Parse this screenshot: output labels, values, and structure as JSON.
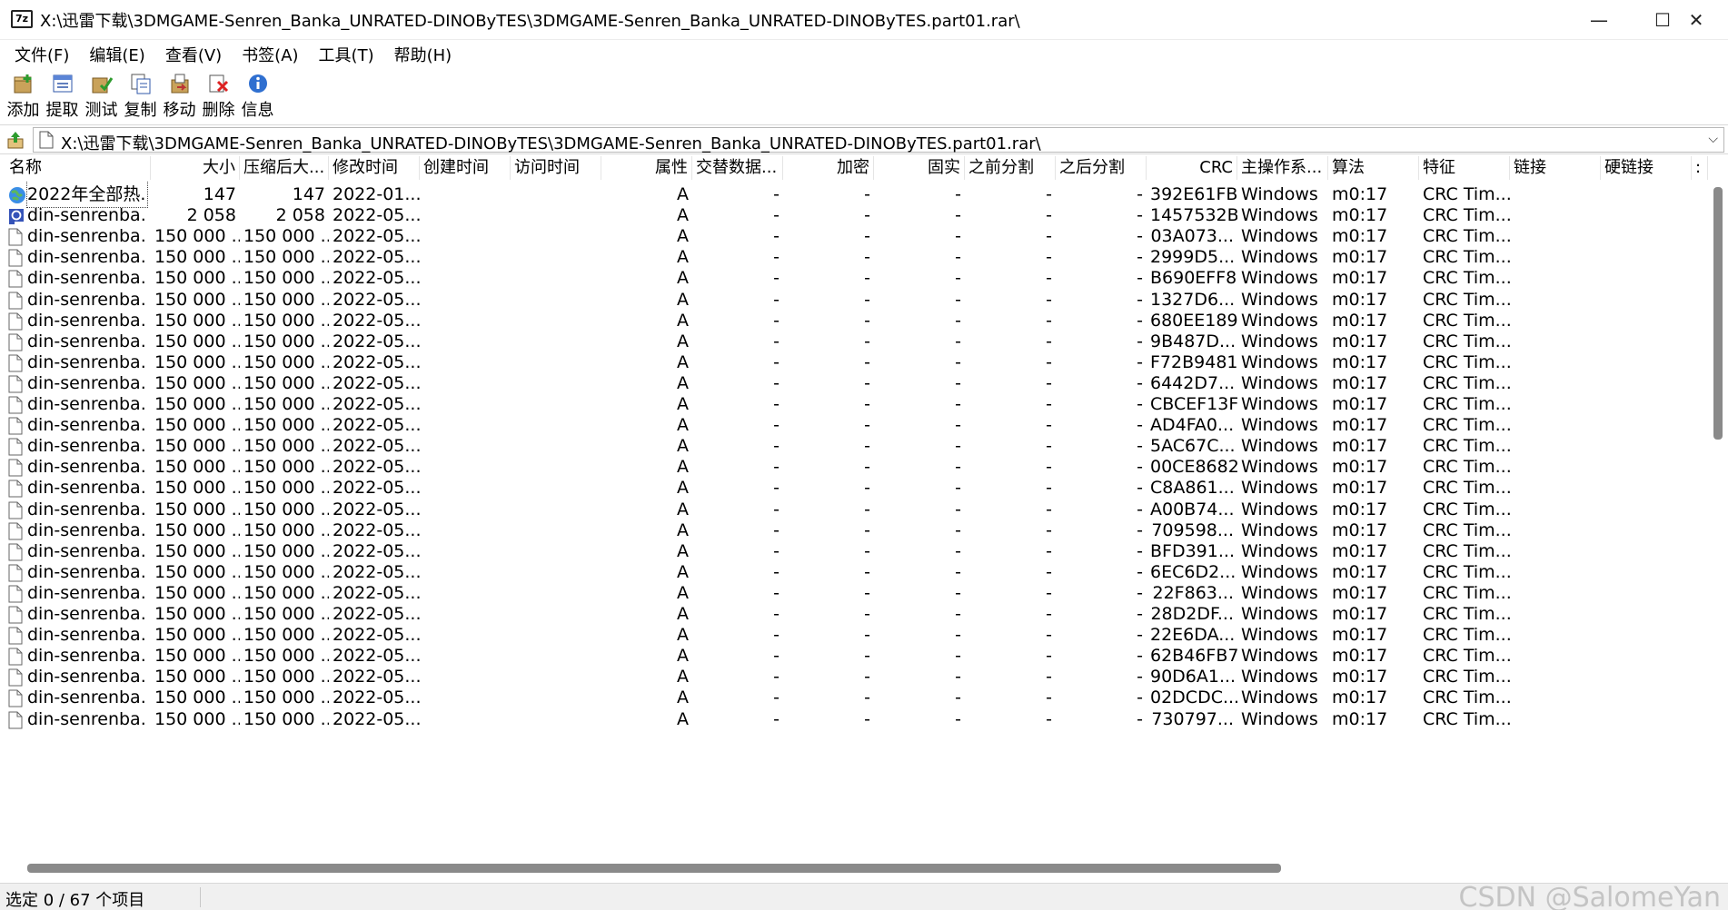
{
  "window": {
    "app_icon_text": "7z",
    "title": "X:\\迅雷下载\\3DMGAME-Senren_Banka_UNRATED-DINOByTES\\3DMGAME-Senren_Banka_UNRATED-DINOByTES.part01.rar\\",
    "minimize_glyph": "—",
    "maximize_glyph": "☐",
    "close_glyph": "✕"
  },
  "menu": [
    "文件(F)",
    "编辑(E)",
    "查看(V)",
    "书签(A)",
    "工具(T)",
    "帮助(H)"
  ],
  "toolbar": [
    {
      "label": "添加",
      "icon": "add-icon"
    },
    {
      "label": "提取",
      "icon": "extract-icon"
    },
    {
      "label": "测试",
      "icon": "test-icon"
    },
    {
      "label": "复制",
      "icon": "copy-icon"
    },
    {
      "label": "移动",
      "icon": "move-icon"
    },
    {
      "label": "删除",
      "icon": "delete-icon"
    },
    {
      "label": "信息",
      "icon": "info-icon"
    }
  ],
  "address": {
    "path": "X:\\迅雷下载\\3DMGAME-Senren_Banka_UNRATED-DINOByTES\\3DMGAME-Senren_Banka_UNRATED-DINOByTES.part01.rar\\",
    "dropdown_glyph": "⌵"
  },
  "columns": [
    "名称",
    "大小",
    "压缩后大...",
    "修改时间",
    "创建时间",
    "访问时间",
    "属性",
    "交替数据...",
    "加密",
    "固实",
    "之前分割",
    "之后分割",
    "CRC",
    "主操作系...",
    "算法",
    "特征",
    "链接",
    "硬链接",
    ":"
  ],
  "rows": [
    {
      "name": "2022年全部热...",
      "icon": "globe-icon",
      "size": "147",
      "packed": "147",
      "mtime": "2022-01...",
      "attr": "A",
      "alt": "-",
      "enc": "-",
      "solid": "-",
      "before": "-",
      "after": "-",
      "crc": "392E61FB",
      "os": "Windows",
      "method": "m0:17",
      "char": "CRC Tim..."
    },
    {
      "name": "din-senrenba...",
      "icon": "url-shortcut-icon",
      "size": "2 058",
      "packed": "2 058",
      "mtime": "2022-05...",
      "attr": "A",
      "alt": "-",
      "enc": "-",
      "solid": "-",
      "before": "-",
      "after": "-",
      "crc": "1457532B",
      "os": "Windows",
      "method": "m0:17",
      "char": "CRC Tim..."
    },
    {
      "name": "din-senrenba...",
      "icon": "file-icon",
      "size": "150 000 ...",
      "packed": "150 000 ...",
      "mtime": "2022-05...",
      "attr": "A",
      "alt": "-",
      "enc": "-",
      "solid": "-",
      "before": "-",
      "after": "-",
      "crc": "03A073...",
      "os": "Windows",
      "method": "m0:17",
      "char": "CRC Tim..."
    },
    {
      "name": "din-senrenba...",
      "icon": "file-icon",
      "size": "150 000 ...",
      "packed": "150 000 ...",
      "mtime": "2022-05...",
      "attr": "A",
      "alt": "-",
      "enc": "-",
      "solid": "-",
      "before": "-",
      "after": "-",
      "crc": "2999D5...",
      "os": "Windows",
      "method": "m0:17",
      "char": "CRC Tim..."
    },
    {
      "name": "din-senrenba...",
      "icon": "file-icon",
      "size": "150 000 ...",
      "packed": "150 000 ...",
      "mtime": "2022-05...",
      "attr": "A",
      "alt": "-",
      "enc": "-",
      "solid": "-",
      "before": "-",
      "after": "-",
      "crc": "B690EFF8",
      "os": "Windows",
      "method": "m0:17",
      "char": "CRC Tim..."
    },
    {
      "name": "din-senrenba...",
      "icon": "file-icon",
      "size": "150 000 ...",
      "packed": "150 000 ...",
      "mtime": "2022-05...",
      "attr": "A",
      "alt": "-",
      "enc": "-",
      "solid": "-",
      "before": "-",
      "after": "-",
      "crc": "1327D6...",
      "os": "Windows",
      "method": "m0:17",
      "char": "CRC Tim..."
    },
    {
      "name": "din-senrenba...",
      "icon": "file-icon",
      "size": "150 000 ...",
      "packed": "150 000 ...",
      "mtime": "2022-05...",
      "attr": "A",
      "alt": "-",
      "enc": "-",
      "solid": "-",
      "before": "-",
      "after": "-",
      "crc": "680EE189",
      "os": "Windows",
      "method": "m0:17",
      "char": "CRC Tim..."
    },
    {
      "name": "din-senrenba...",
      "icon": "file-icon",
      "size": "150 000 ...",
      "packed": "150 000 ...",
      "mtime": "2022-05...",
      "attr": "A",
      "alt": "-",
      "enc": "-",
      "solid": "-",
      "before": "-",
      "after": "-",
      "crc": "9B487D...",
      "os": "Windows",
      "method": "m0:17",
      "char": "CRC Tim..."
    },
    {
      "name": "din-senrenba...",
      "icon": "file-icon",
      "size": "150 000 ...",
      "packed": "150 000 ...",
      "mtime": "2022-05...",
      "attr": "A",
      "alt": "-",
      "enc": "-",
      "solid": "-",
      "before": "-",
      "after": "-",
      "crc": "F72B9481",
      "os": "Windows",
      "method": "m0:17",
      "char": "CRC Tim..."
    },
    {
      "name": "din-senrenba...",
      "icon": "file-icon",
      "size": "150 000 ...",
      "packed": "150 000 ...",
      "mtime": "2022-05...",
      "attr": "A",
      "alt": "-",
      "enc": "-",
      "solid": "-",
      "before": "-",
      "after": "-",
      "crc": "6442D7...",
      "os": "Windows",
      "method": "m0:17",
      "char": "CRC Tim..."
    },
    {
      "name": "din-senrenba...",
      "icon": "file-icon",
      "size": "150 000 ...",
      "packed": "150 000 ...",
      "mtime": "2022-05...",
      "attr": "A",
      "alt": "-",
      "enc": "-",
      "solid": "-",
      "before": "-",
      "after": "-",
      "crc": "CBCEF13F",
      "os": "Windows",
      "method": "m0:17",
      "char": "CRC Tim..."
    },
    {
      "name": "din-senrenba...",
      "icon": "file-icon",
      "size": "150 000 ...",
      "packed": "150 000 ...",
      "mtime": "2022-05...",
      "attr": "A",
      "alt": "-",
      "enc": "-",
      "solid": "-",
      "before": "-",
      "after": "-",
      "crc": "AD4FA0...",
      "os": "Windows",
      "method": "m0:17",
      "char": "CRC Tim..."
    },
    {
      "name": "din-senrenba...",
      "icon": "file-icon",
      "size": "150 000 ...",
      "packed": "150 000 ...",
      "mtime": "2022-05...",
      "attr": "A",
      "alt": "-",
      "enc": "-",
      "solid": "-",
      "before": "-",
      "after": "-",
      "crc": "5AC67C...",
      "os": "Windows",
      "method": "m0:17",
      "char": "CRC Tim..."
    },
    {
      "name": "din-senrenba...",
      "icon": "file-icon",
      "size": "150 000 ...",
      "packed": "150 000 ...",
      "mtime": "2022-05...",
      "attr": "A",
      "alt": "-",
      "enc": "-",
      "solid": "-",
      "before": "-",
      "after": "-",
      "crc": "00CE8682",
      "os": "Windows",
      "method": "m0:17",
      "char": "CRC Tim..."
    },
    {
      "name": "din-senrenba...",
      "icon": "file-icon",
      "size": "150 000 ...",
      "packed": "150 000 ...",
      "mtime": "2022-05...",
      "attr": "A",
      "alt": "-",
      "enc": "-",
      "solid": "-",
      "before": "-",
      "after": "-",
      "crc": "C8A861...",
      "os": "Windows",
      "method": "m0:17",
      "char": "CRC Tim..."
    },
    {
      "name": "din-senrenba...",
      "icon": "file-icon",
      "size": "150 000 ...",
      "packed": "150 000 ...",
      "mtime": "2022-05...",
      "attr": "A",
      "alt": "-",
      "enc": "-",
      "solid": "-",
      "before": "-",
      "after": "-",
      "crc": "A00B74...",
      "os": "Windows",
      "method": "m0:17",
      "char": "CRC Tim..."
    },
    {
      "name": "din-senrenba...",
      "icon": "file-icon",
      "size": "150 000 ...",
      "packed": "150 000 ...",
      "mtime": "2022-05...",
      "attr": "A",
      "alt": "-",
      "enc": "-",
      "solid": "-",
      "before": "-",
      "after": "-",
      "crc": "709598...",
      "os": "Windows",
      "method": "m0:17",
      "char": "CRC Tim..."
    },
    {
      "name": "din-senrenba...",
      "icon": "file-icon",
      "size": "150 000 ...",
      "packed": "150 000 ...",
      "mtime": "2022-05...",
      "attr": "A",
      "alt": "-",
      "enc": "-",
      "solid": "-",
      "before": "-",
      "after": "-",
      "crc": "BFD391...",
      "os": "Windows",
      "method": "m0:17",
      "char": "CRC Tim..."
    },
    {
      "name": "din-senrenba...",
      "icon": "file-icon",
      "size": "150 000 ...",
      "packed": "150 000 ...",
      "mtime": "2022-05...",
      "attr": "A",
      "alt": "-",
      "enc": "-",
      "solid": "-",
      "before": "-",
      "after": "-",
      "crc": "6EC6D2...",
      "os": "Windows",
      "method": "m0:17",
      "char": "CRC Tim..."
    },
    {
      "name": "din-senrenba...",
      "icon": "file-icon",
      "size": "150 000 ...",
      "packed": "150 000 ...",
      "mtime": "2022-05...",
      "attr": "A",
      "alt": "-",
      "enc": "-",
      "solid": "-",
      "before": "-",
      "after": "-",
      "crc": "22F863...",
      "os": "Windows",
      "method": "m0:17",
      "char": "CRC Tim..."
    },
    {
      "name": "din-senrenba...",
      "icon": "file-icon",
      "size": "150 000 ...",
      "packed": "150 000 ...",
      "mtime": "2022-05...",
      "attr": "A",
      "alt": "-",
      "enc": "-",
      "solid": "-",
      "before": "-",
      "after": "-",
      "crc": "28D2DF...",
      "os": "Windows",
      "method": "m0:17",
      "char": "CRC Tim..."
    },
    {
      "name": "din-senrenba...",
      "icon": "file-icon",
      "size": "150 000 ...",
      "packed": "150 000 ...",
      "mtime": "2022-05...",
      "attr": "A",
      "alt": "-",
      "enc": "-",
      "solid": "-",
      "before": "-",
      "after": "-",
      "crc": "22E6DA...",
      "os": "Windows",
      "method": "m0:17",
      "char": "CRC Tim..."
    },
    {
      "name": "din-senrenba...",
      "icon": "file-icon",
      "size": "150 000 ...",
      "packed": "150 000 ...",
      "mtime": "2022-05...",
      "attr": "A",
      "alt": "-",
      "enc": "-",
      "solid": "-",
      "before": "-",
      "after": "-",
      "crc": "62B46FB7",
      "os": "Windows",
      "method": "m0:17",
      "char": "CRC Tim..."
    },
    {
      "name": "din-senrenba...",
      "icon": "file-icon",
      "size": "150 000 ...",
      "packed": "150 000 ...",
      "mtime": "2022-05...",
      "attr": "A",
      "alt": "-",
      "enc": "-",
      "solid": "-",
      "before": "-",
      "after": "-",
      "crc": "90D6A1...",
      "os": "Windows",
      "method": "m0:17",
      "char": "CRC Tim..."
    },
    {
      "name": "din-senrenba...",
      "icon": "file-icon",
      "size": "150 000 ...",
      "packed": "150 000 ...",
      "mtime": "2022-05...",
      "attr": "A",
      "alt": "-",
      "enc": "-",
      "solid": "-",
      "before": "-",
      "after": "-",
      "crc": "02DCDC...",
      "os": "Windows",
      "method": "m0:17",
      "char": "CRC Tim..."
    },
    {
      "name": "din-senrenba...",
      "icon": "file-icon",
      "size": "150 000 ...",
      "packed": "150 000 ...",
      "mtime": "2022-05...",
      "attr": "A",
      "alt": "-",
      "enc": "-",
      "solid": "-",
      "before": "-",
      "after": "-",
      "crc": "730797...",
      "os": "Windows",
      "method": "m0:17",
      "char": "CRC Tim..."
    }
  ],
  "status": {
    "selection": "选定 0 / 67 个项目"
  },
  "watermark": "CSDN @SalomeYan"
}
